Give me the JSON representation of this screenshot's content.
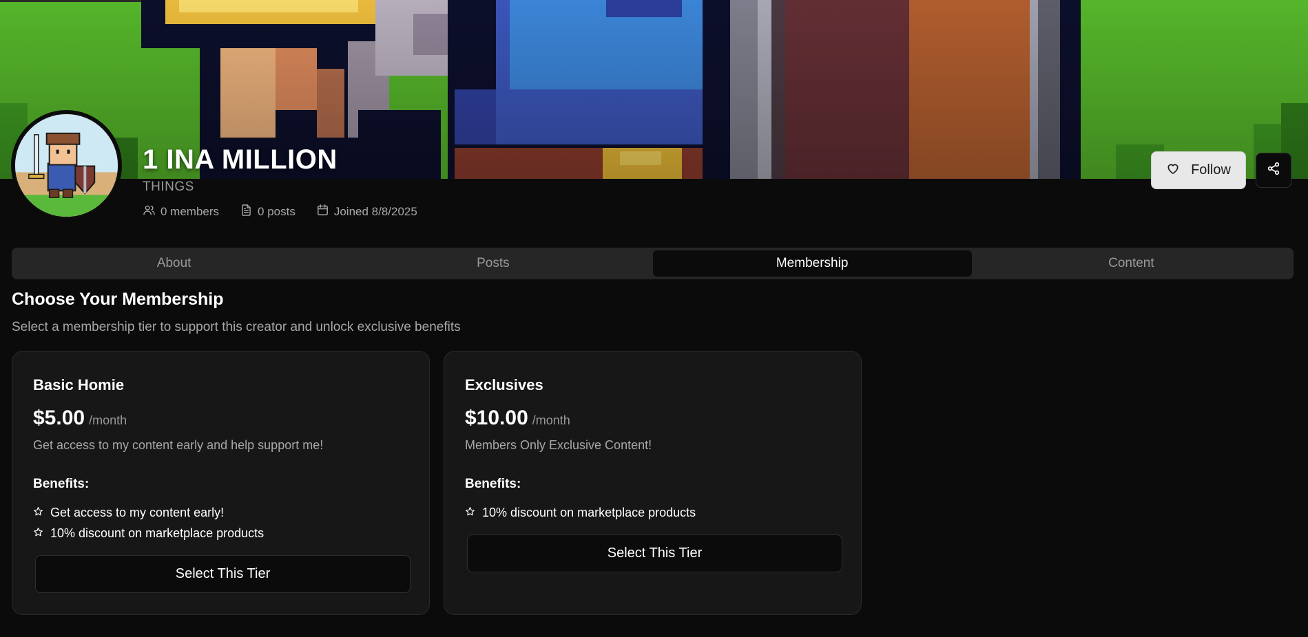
{
  "creator": {
    "name": "1 INA MILLION",
    "tagline": "THINGS",
    "stats": {
      "members": "0 members",
      "posts": "0 posts",
      "joined": "Joined 8/8/2025"
    }
  },
  "actions": {
    "follow_label": "Follow"
  },
  "tabs": [
    {
      "label": "About",
      "active": false
    },
    {
      "label": "Posts",
      "active": false
    },
    {
      "label": "Membership",
      "active": true
    },
    {
      "label": "Content",
      "active": false
    }
  ],
  "membership": {
    "title": "Choose Your Membership",
    "subtitle": "Select a membership tier to support this creator and unlock exclusive benefits",
    "tiers": [
      {
        "name": "Basic Homie",
        "price": "$5.00",
        "period": "/month",
        "description": "Get access to my content early and help support me!",
        "benefits_label": "Benefits:",
        "benefits": [
          "Get access to my content early!",
          "10% discount on marketplace products"
        ],
        "button_label": "Select This Tier"
      },
      {
        "name": "Exclusives",
        "price": "$10.00",
        "period": "/month",
        "description": "Members Only Exclusive Content!",
        "benefits_label": "Benefits:",
        "benefits": [
          "10% discount on marketplace products"
        ],
        "button_label": "Select This Tier"
      }
    ]
  },
  "colors": {
    "background": "#0b0b0b",
    "card": "#171717",
    "tab_bar": "#262626",
    "follow_button": "#e8e8e8",
    "muted_text": "#a8a8a8",
    "banner_green": "#55b52a"
  },
  "icons": {
    "members": "users-icon",
    "posts": "file-text-icon",
    "joined": "calendar-icon",
    "follow": "heart-icon",
    "share": "share-icon",
    "benefit": "star-icon"
  }
}
